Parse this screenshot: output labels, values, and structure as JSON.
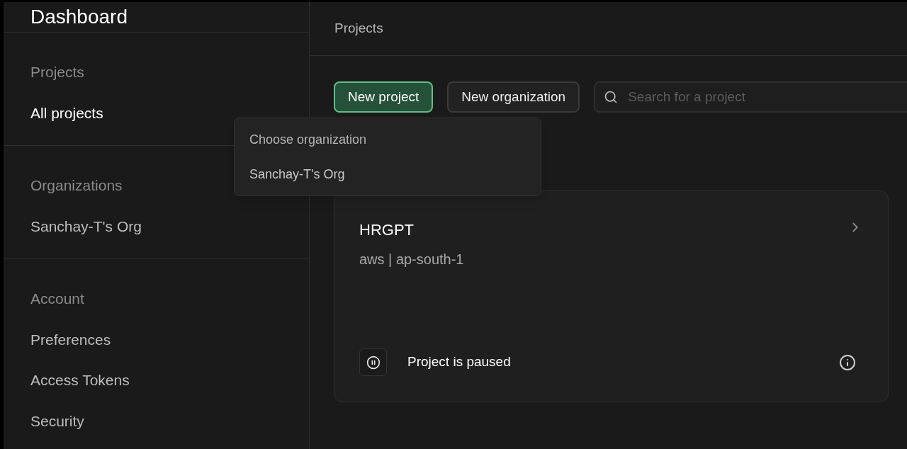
{
  "sidebar": {
    "title": "Dashboard",
    "sections": [
      {
        "heading": "Projects",
        "items": [
          {
            "label": "All projects",
            "selected": true
          }
        ]
      },
      {
        "heading": "Organizations",
        "items": [
          {
            "label": "Sanchay-T's Org",
            "selected": false
          }
        ]
      },
      {
        "heading": "Account",
        "items": [
          {
            "label": "Preferences",
            "selected": false
          },
          {
            "label": "Access Tokens",
            "selected": false
          },
          {
            "label": "Security",
            "selected": false
          }
        ]
      }
    ]
  },
  "header": {
    "breadcrumb": "Projects"
  },
  "toolbar": {
    "buttons": [
      {
        "label": "New project",
        "kind": "primary"
      },
      {
        "label": "New organization",
        "kind": "secondary"
      }
    ],
    "search": {
      "placeholder": "Search for a project"
    }
  },
  "dropdown": {
    "label": "Choose organization",
    "items": [
      "Sanchay-T's Org"
    ]
  },
  "projects": [
    {
      "name": "HRGPT",
      "region": "aws | ap-south-1",
      "status": "Project is paused"
    }
  ]
}
